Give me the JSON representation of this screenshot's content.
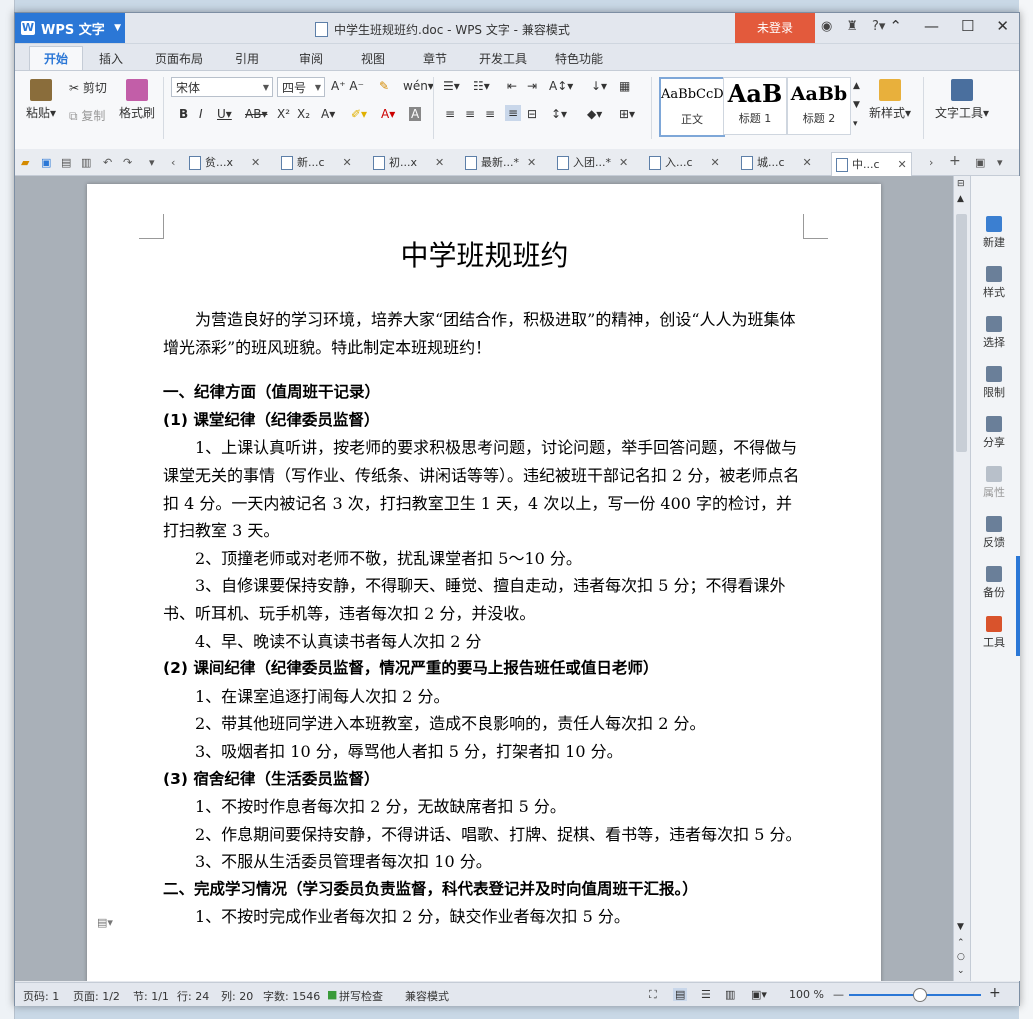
{
  "app": {
    "logo": "WPS 文字",
    "title": "中学生班规班约.doc - WPS 文字 - 兼容模式",
    "login": "未登录"
  },
  "menu_tabs": [
    "开始",
    "插入",
    "页面布局",
    "引用",
    "审阅",
    "视图",
    "章节",
    "开发工具",
    "特色功能"
  ],
  "ribbon": {
    "paste": "粘贴",
    "cut": "剪切",
    "copy": "复制",
    "format_painter": "格式刷",
    "font": "宋体",
    "size": "四号",
    "styles": [
      {
        "sample": "AaBbCcD",
        "label": "正文"
      },
      {
        "sample": "AaB",
        "label": "标题 1"
      },
      {
        "sample": "AaBb",
        "label": "标题 2"
      }
    ],
    "new_style": "新样式",
    "text_tools": "文字工具"
  },
  "doc_tabs": [
    "贫...x",
    "新...c",
    "初...x",
    "最新...*",
    "入团...*",
    "入...c",
    "城...c",
    "中...c"
  ],
  "document": {
    "title": "中学班规班约",
    "intro": "为营造良好的学习环境，培养大家“团结合作，积极进取”的精神，创设“人人为班集体增光添彩”的班风班貌。特此制定本班规班约！",
    "paragraphs": [
      {
        "bold": true,
        "text": "一、纪律方面（值周班干记录）"
      },
      {
        "bold": true,
        "text": "(1)  课堂纪律（纪律委员监督）"
      },
      {
        "bold": false,
        "text": "1、上课认真听讲，按老师的要求积极思考问题，讨论问题，举手回答问题，不得做与课堂无关的事情（写作业、传纸条、讲闲话等等）。违纪被班干部记名扣 2 分，被老师点名扣 4 分。一天内被记名 3 次，打扫教室卫生 1 天，4 次以上，写一份 400 字的检讨，并打扫教室 3 天。"
      },
      {
        "bold": false,
        "text": "2、顶撞老师或对老师不敬，扰乱课堂者扣 5～10 分。"
      },
      {
        "bold": false,
        "text": "3、自修课要保持安静，不得聊天、睡觉、擅自走动，违者每次扣 5 分；不得看课外书、听耳机、玩手机等，违者每次扣 2 分，并没收。"
      },
      {
        "bold": false,
        "text": "4、早、晚读不认真读书者每人次扣 2 分"
      },
      {
        "bold": true,
        "text": "(2)  课间纪律（纪律委员监督，情况严重的要马上报告班任或值日老师）"
      },
      {
        "bold": false,
        "text": "1、在课室追逐打闹每人次扣 2 分。"
      },
      {
        "bold": false,
        "text": "2、带其他班同学进入本班教室，造成不良影响的，责任人每次扣 2 分。"
      },
      {
        "bold": false,
        "text": "3、吸烟者扣 10 分，辱骂他人者扣 5 分，打架者扣 10 分。"
      },
      {
        "bold": true,
        "text": "(3)  宿舍纪律（生活委员监督）"
      },
      {
        "bold": false,
        "text": "1、不按时作息者每次扣 2 分，无故缺席者扣 5 分。"
      },
      {
        "bold": false,
        "text": "2、作息期间要保持安静，不得讲话、唱歌、打牌、捉棋、看书等，违者每次扣 5 分。"
      },
      {
        "bold": false,
        "text": "3、不服从生活委员管理者每次扣 10 分。"
      },
      {
        "bold": true,
        "text": "二、完成学习情况（学习委员负责监督，科代表登记并及时向值周班干汇报。）"
      },
      {
        "bold": false,
        "text": "1、不按时完成作业者每次扣 2 分，缺交作业者每次扣 5 分。"
      }
    ]
  },
  "side_panel": [
    "新建",
    "样式",
    "选择",
    "限制",
    "分享",
    "属性",
    "反馈",
    "备份",
    "工具"
  ],
  "status": {
    "page_code": "页码: 1",
    "page": "页面: 1/2",
    "section": "节: 1/1",
    "row": "行: 24",
    "col": "列: 20",
    "chars": "字数: 1546",
    "spell": "拼写检查",
    "mode": "兼容模式",
    "zoom": "100 %"
  }
}
